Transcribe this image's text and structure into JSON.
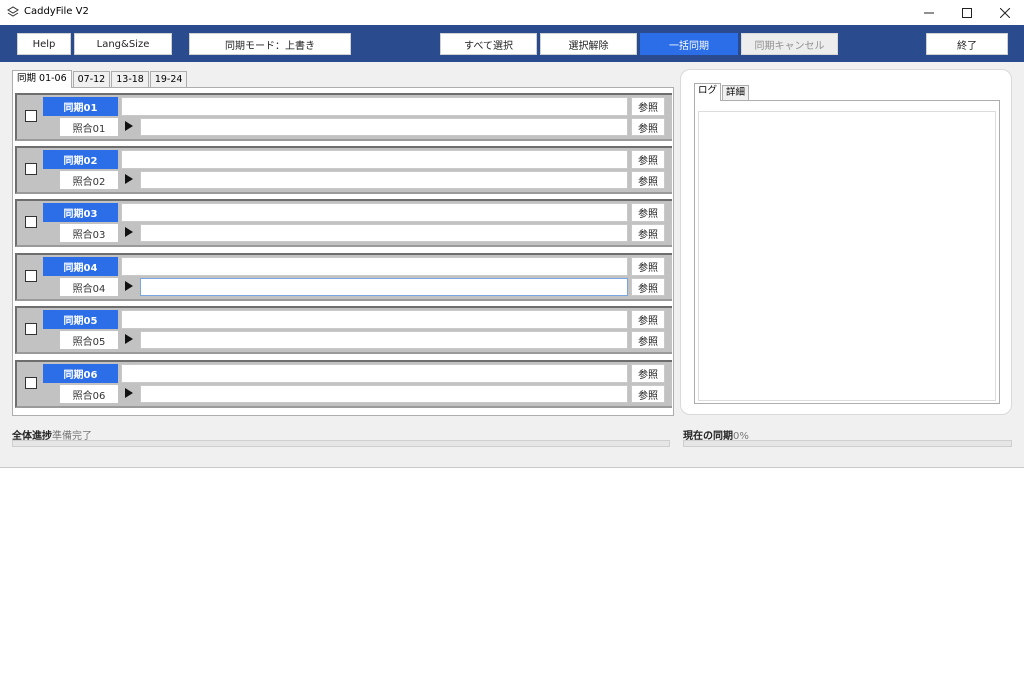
{
  "window": {
    "title": "CaddyFile V2"
  },
  "toolbar": {
    "help": "Help",
    "lang_size": "Lang&Size",
    "sync_mode": "同期モード：上書き",
    "select_all": "すべて選択",
    "deselect": "選択解除",
    "batch_sync": "一括同期",
    "sync_cancel": "同期キャンセル",
    "exit": "終了"
  },
  "tabs": [
    "同期 01-06",
    "07-12",
    "13-18",
    "19-24"
  ],
  "groups": [
    {
      "sync": "同期01",
      "ref": "照合01",
      "sync_path": "",
      "ref_path": "",
      "checked": false
    },
    {
      "sync": "同期02",
      "ref": "照合02",
      "sync_path": "",
      "ref_path": "",
      "checked": false
    },
    {
      "sync": "同期03",
      "ref": "照合03",
      "sync_path": "",
      "ref_path": "",
      "checked": false
    },
    {
      "sync": "同期04",
      "ref": "照合04",
      "sync_path": "",
      "ref_path": "",
      "checked": false
    },
    {
      "sync": "同期05",
      "ref": "照合05",
      "sync_path": "",
      "ref_path": "",
      "checked": false
    },
    {
      "sync": "同期06",
      "ref": "照合06",
      "sync_path": "",
      "ref_path": "",
      "checked": false
    }
  ],
  "browse_label": "参照",
  "right_tabs": [
    "ログ",
    "詳細"
  ],
  "log_text": "",
  "status": {
    "overall_label": "全体進捗",
    "overall_value": "準備完了",
    "overall_progress": 0,
    "current_label": "現在の同期",
    "current_value": "0%",
    "current_progress": 0
  },
  "colors": {
    "toolbar_bg": "#2a4b8d",
    "accent": "#2b6ee8",
    "group_bg": "#c2c2c2"
  }
}
